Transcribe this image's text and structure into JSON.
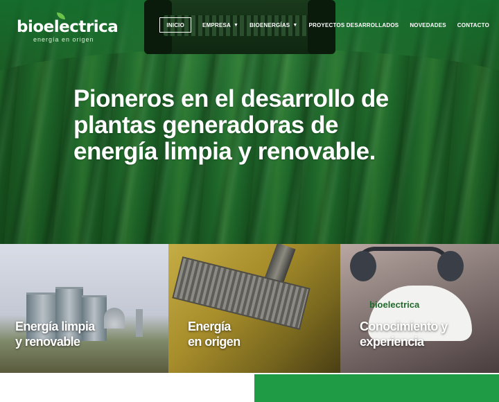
{
  "brand": {
    "name": "bioelectrica",
    "tagline": "energía en origen"
  },
  "nav": {
    "items": [
      {
        "label": "INICIO",
        "active": true,
        "dropdown": false
      },
      {
        "label": "EMPRESA",
        "active": false,
        "dropdown": true
      },
      {
        "label": "BIOENERGÍAS",
        "active": false,
        "dropdown": true
      },
      {
        "label": "PROYECTOS DESARROLLADOS",
        "active": false,
        "dropdown": false
      },
      {
        "label": "NOVEDADES",
        "active": false,
        "dropdown": false
      },
      {
        "label": "CONTACTO",
        "active": false,
        "dropdown": false
      }
    ],
    "caret_icon": "caret-down-icon"
  },
  "hero": {
    "headline_lines": [
      "Pioneros en el desarrollo de",
      "plantas generadoras de",
      "energía limpia y renovable."
    ]
  },
  "tiles": [
    {
      "lines": [
        "Energía limpia",
        "y renovable"
      ]
    },
    {
      "lines": [
        "Energía",
        "en origen"
      ]
    },
    {
      "lines": [
        "Conocimiento y",
        "experiencia"
      ],
      "helmet_text": "bioelectrica"
    }
  ],
  "colors": {
    "brand_green": "#1f9a45",
    "hero_green": "#1f6a2c",
    "white": "#ffffff"
  }
}
